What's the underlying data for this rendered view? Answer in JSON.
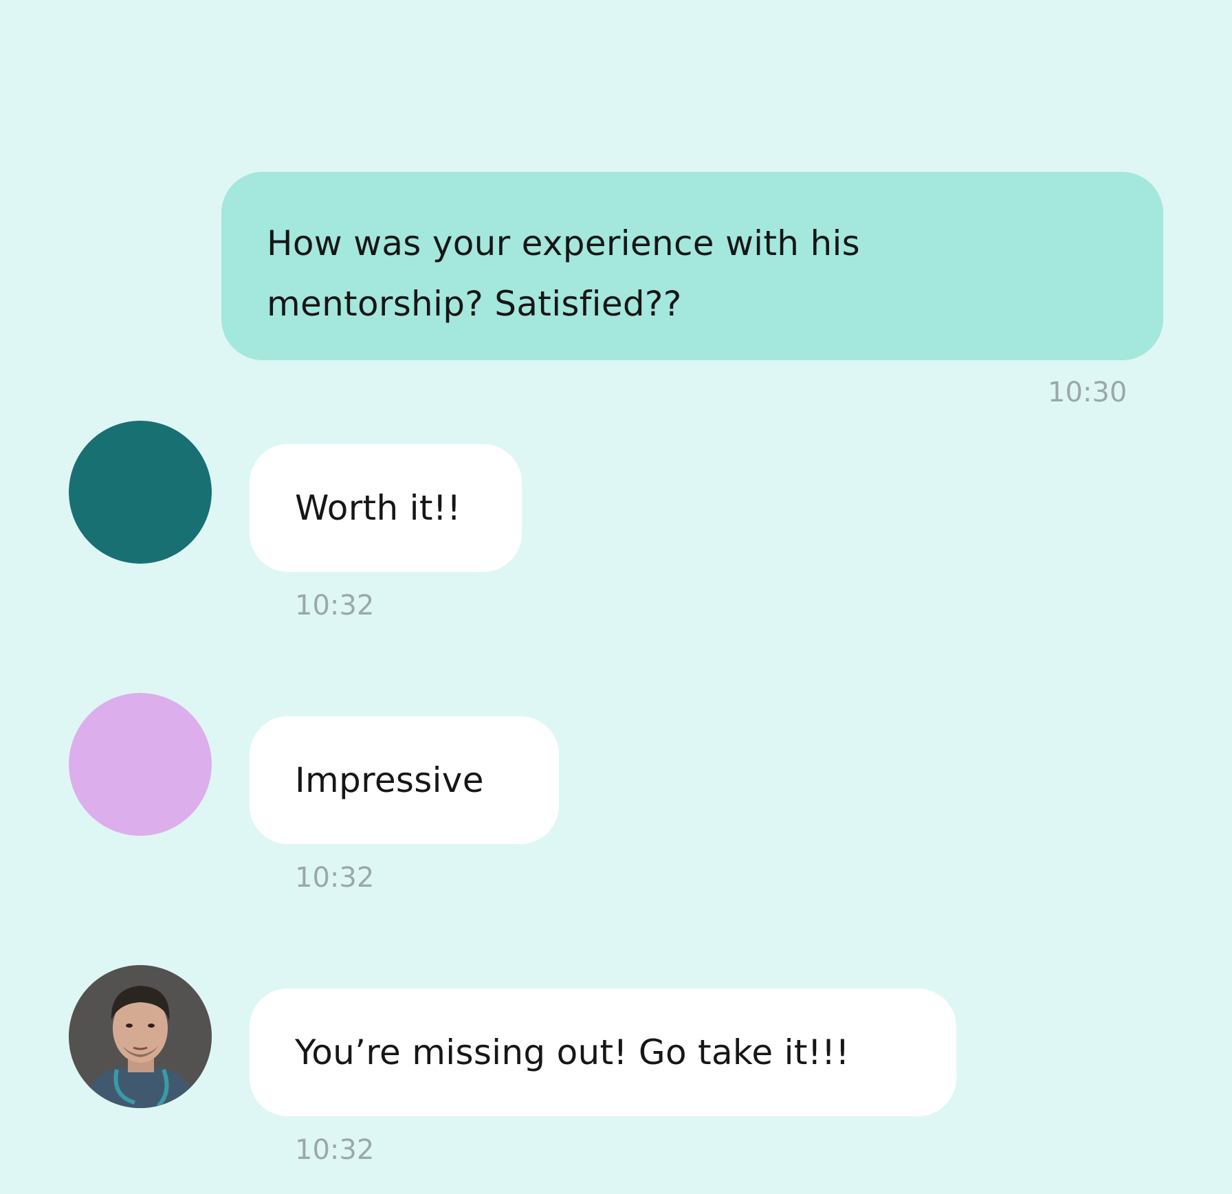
{
  "colors": {
    "background": "#dff7f4",
    "sent_bubble": "#a4e7dd",
    "received_bubble": "#ffffff",
    "avatar_teal": "#187073",
    "avatar_lilac": "#ddaeec"
  },
  "messages": [
    {
      "sender": "me",
      "text": "How was your experience with his mentorship? Satisfied??",
      "time": "10:30"
    },
    {
      "sender": "other",
      "avatar": "teal-circle",
      "text": "Worth it!!",
      "time": "10:32"
    },
    {
      "sender": "other",
      "avatar": "lilac-circle",
      "text": "Impressive",
      "time": "10:32"
    },
    {
      "sender": "other",
      "avatar": "photo-man",
      "text": "You’re missing out! Go take it!!!",
      "time": "10:32"
    }
  ]
}
